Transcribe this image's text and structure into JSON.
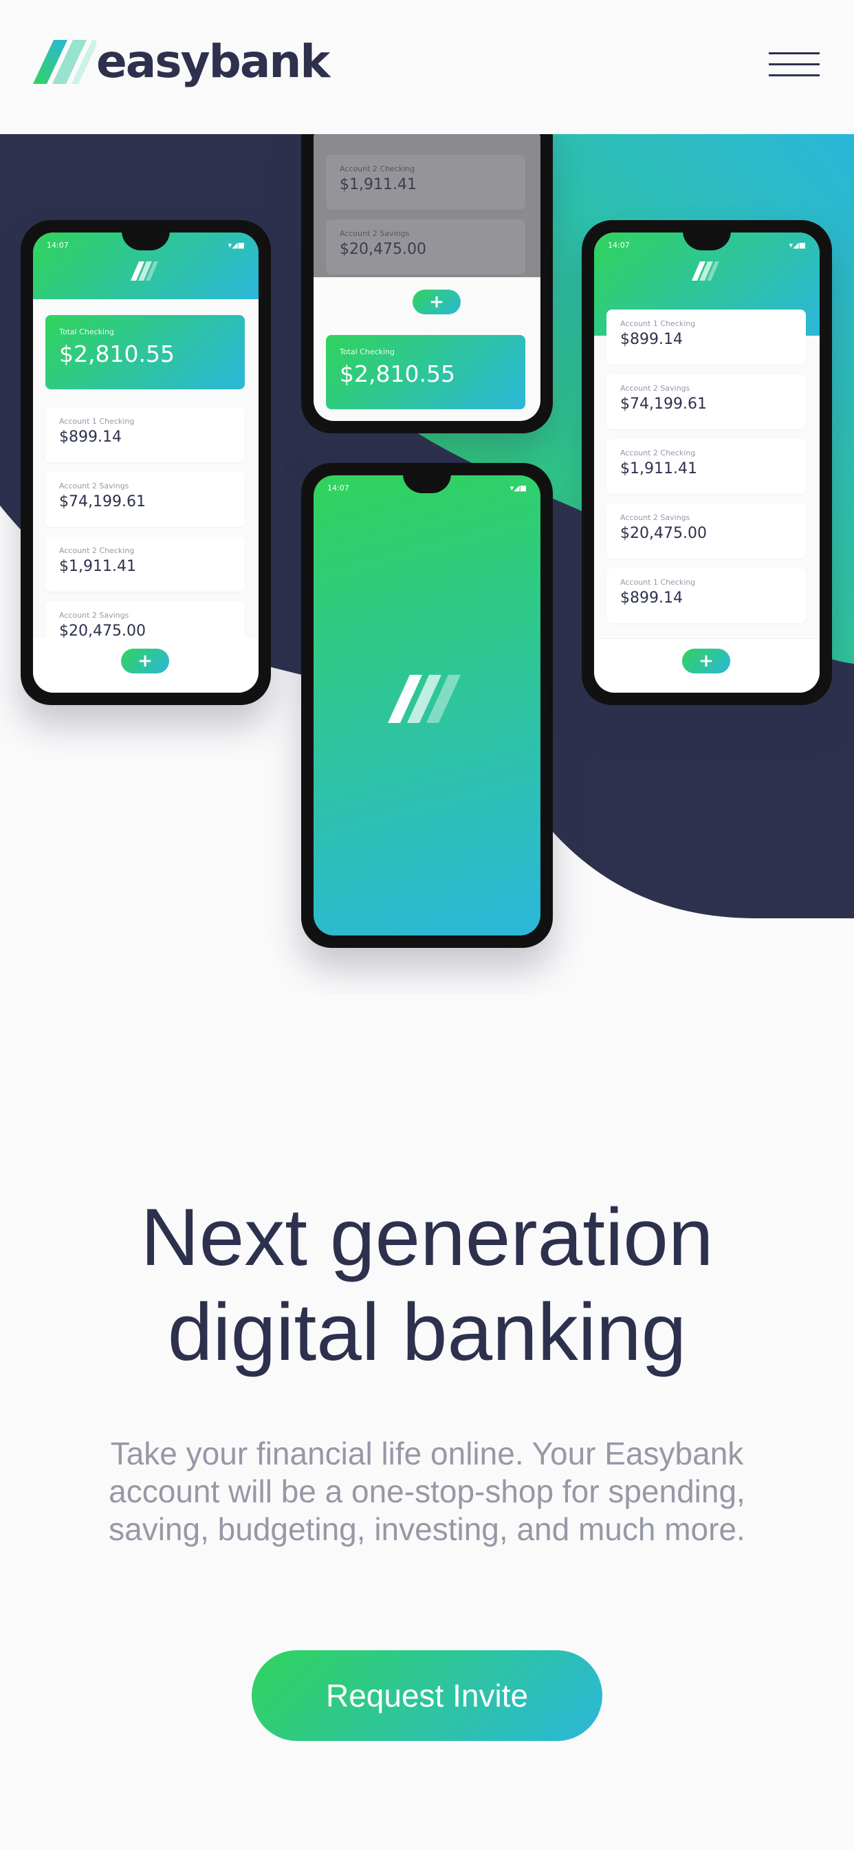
{
  "brand": {
    "name": "easybank"
  },
  "header": {
    "menu_icon": "hamburger-icon"
  },
  "phones": {
    "left": {
      "time": "14:07",
      "total_label": "Total Checking",
      "total_amount": "$2,810.55",
      "accounts": [
        {
          "label": "Account 1 Checking",
          "amount": "$899.14"
        },
        {
          "label": "Account 2 Savings",
          "amount": "$74,199.61"
        },
        {
          "label": "Account 2 Checking",
          "amount": "$1,911.41"
        },
        {
          "label": "Account 2 Savings",
          "amount": "$20,475.00"
        }
      ]
    },
    "top_center": {
      "accounts": [
        {
          "label": "Account 2 Checking",
          "amount": "$1,911.41"
        },
        {
          "label": "Account 2 Savings",
          "amount": "$20,475.00"
        }
      ],
      "total_label": "Total Checking",
      "total_amount": "$2,810.55"
    },
    "center": {
      "time": "14:07"
    },
    "right": {
      "time": "14:07",
      "accounts": [
        {
          "label": "Account 1 Checking",
          "amount": "$899.14"
        },
        {
          "label": "Account 2 Savings",
          "amount": "$74,199.61"
        },
        {
          "label": "Account 2 Checking",
          "amount": "$1,911.41"
        },
        {
          "label": "Account 2 Savings",
          "amount": "$20,475.00"
        },
        {
          "label": "Account 1 Checking",
          "amount": "$899.14"
        }
      ]
    }
  },
  "hero": {
    "headline_line1": "Next generation",
    "headline_line2": "digital banking",
    "subtext": "Take your financial life online. Your Easybank account will be a one-stop-shop for spending, saving, budgeting, investing, and much more.",
    "cta_label": "Request Invite"
  },
  "colors": {
    "dark_blue": "#2d314d",
    "lime_green": "#31d35c",
    "bright_cyan": "#2bb7da",
    "grayish_blue": "#9698a6",
    "background": "#fafafb"
  }
}
